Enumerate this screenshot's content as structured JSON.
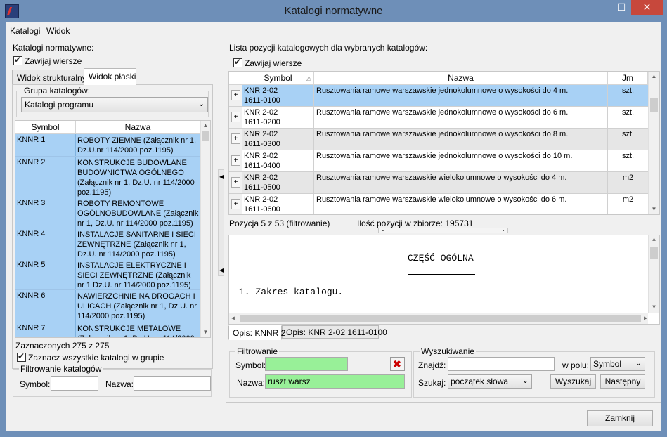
{
  "window": {
    "title": "Katalogi normatywne",
    "min": "—",
    "max": "☐",
    "close": "✕"
  },
  "menu": {
    "items": [
      "Katalogi",
      "Widok"
    ]
  },
  "left": {
    "section_label": "Katalogi normatywne:",
    "wrap_rows_label": "Zawijaj wiersze",
    "tabs": [
      "Widok strukturalny",
      "Widok płaski"
    ],
    "group_label": "Grupa katalogów:",
    "group_select": "Katalogi programu",
    "columns": [
      "Symbol",
      "Nazwa"
    ],
    "rows": [
      {
        "symbol": "KNNR 1",
        "name": "ROBOTY ZIEMNE (Załącznik nr 1, Dz.U.nr 114/2000 poz.1195)"
      },
      {
        "symbol": "KNNR 2",
        "name": "KONSTRUKCJE BUDOWLANE BUDOWNICTWA OGÓLNEGO (Załącznik nr 1, Dz.U. nr 114/2000 poz.1195)"
      },
      {
        "symbol": "KNNR 3",
        "name": "ROBOTY REMONTOWE OGÓLNOBUDOWLANE (Załącznik nr 1, Dz.U. nr 114/2000 poz.1195)"
      },
      {
        "symbol": "KNNR 4",
        "name": "INSTALACJE SANITARNE I SIECI ZEWNĘTRZNE (Załącznik nr 1, Dz.U. nr 114/2000 poz.1195)"
      },
      {
        "symbol": "KNNR 5",
        "name": "INSTALACJE ELEKTRYCZNE I SIECI ZEWNĘTRZNE (Załącznik nr 1 Dz.U. nr 114/2000 poz.1195)"
      },
      {
        "symbol": "KNNR 6",
        "name": "NAWIERZCHNIE NA DROGACH I ULICACH (Załącznik nr 1, Dz.U. nr 114/2000 poz.1195)"
      },
      {
        "symbol": "KNNR 7",
        "name": "KONSTRUKCJE METALOWE (Załącznik nr 1, Dz.U. nr 114/2000"
      }
    ],
    "selected_count": "Zaznaczonych 275 z 275",
    "select_all_label": "Zaznacz wszystkie katalogi w grupie",
    "filter_group": "Filtrowanie katalogów",
    "filter_symbol_label": "Symbol:",
    "filter_name_label": "Nazwa:",
    "filter_symbol_value": "",
    "filter_name_value": ""
  },
  "right": {
    "section_label": "Lista pozycji katalogowych dla wybranych katalogów:",
    "wrap_rows_label": "Zawijaj wiersze",
    "columns": [
      "Symbol",
      "Nazwa",
      "Jm"
    ],
    "rows": [
      {
        "plus": "+",
        "symbol1": "KNR 2-02",
        "symbol2": "1611-0100",
        "name": "Rusztowania ramowe warszawskie jednokolumnowe o wysokości do 4 m.",
        "jm": "szt."
      },
      {
        "plus": "+",
        "symbol1": "KNR 2-02",
        "symbol2": "1611-0200",
        "name": "Rusztowania ramowe warszawskie jednokolumnowe o wysokości do 6 m.",
        "jm": "szt."
      },
      {
        "plus": "+",
        "symbol1": "KNR 2-02",
        "symbol2": "1611-0300",
        "name": "Rusztowania ramowe warszawskie jednokolumnowe o wysokości do 8 m.",
        "jm": "szt."
      },
      {
        "plus": "+",
        "symbol1": "KNR 2-02",
        "symbol2": "1611-0400",
        "name": "Rusztowania ramowe warszawskie jednokolumnowe o wysokości do 10 m.",
        "jm": "szt."
      },
      {
        "plus": "+",
        "symbol1": "KNR 2-02",
        "symbol2": "1611-0500",
        "name": "Rusztowania ramowe warszawskie wielokolumnowe o wysokości do 4 m.",
        "jm": "m2"
      },
      {
        "plus": "+",
        "symbol1": "KNR 2-02",
        "symbol2": "1611-0600",
        "name": "Rusztowania ramowe warszawskie wielokolumnowe o wysokości do 6 m.",
        "jm": "m2"
      }
    ],
    "position_status": "Pozycja 5 z 53 (filtrowanie)",
    "count_status": "Ilość pozycji w zbiorze: 195731",
    "doc_heading": "CZĘŚĆ OGÓLNA",
    "doc_line1": "1. Zakres katalogu.",
    "doc_tabs": [
      "Opis: KNNR 2",
      "Opis: KNR 2-02 1611-0100"
    ],
    "filter_group": "Filtrowanie",
    "filter_symbol_label": "Symbol:",
    "filter_symbol_value": "",
    "filter_name_label": "Nazwa:",
    "filter_name_value": "ruszt warsz",
    "search_group": "Wyszukiwanie",
    "find_label": "Znajdź:",
    "find_value": "",
    "in_field_label": "w polu:",
    "in_field_value": "Symbol",
    "search_mode_label": "Szukaj:",
    "search_mode_value": "początek słowa",
    "search_button": "Wyszukaj",
    "next_button": "Następny"
  },
  "footer": {
    "close_button": "Zamknij"
  },
  "colors": {
    "selected_row": "#a8d1f5",
    "filter_green": "#98f098",
    "close_red": "#c7483c"
  }
}
